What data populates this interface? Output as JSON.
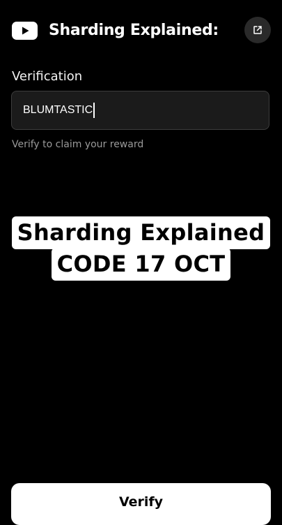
{
  "header": {
    "title": "Sharding Explained:",
    "brand_icon": "youtube-icon",
    "action_icon": "external-link-icon"
  },
  "verification": {
    "label": "Verification",
    "input_value": "BLUMTASTIC",
    "hint": "Verify to claim your reward"
  },
  "video_overlay": {
    "line1": "Sharding Explained",
    "line2": "CODE 17 OCT"
  },
  "footer": {
    "verify_label": "Verify"
  },
  "colors": {
    "background": "#000000",
    "input_background": "#1b1b1b",
    "input_border": "#3d3d3d",
    "hint_text": "#9a9a9a",
    "button_background": "#ffffff"
  }
}
